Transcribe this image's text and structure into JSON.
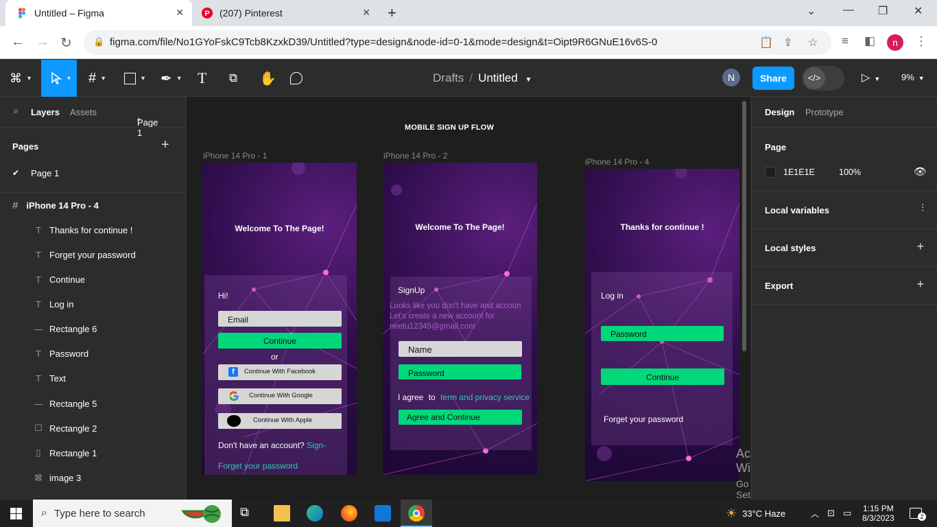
{
  "browser": {
    "tabs": [
      {
        "title": "Untitled – Figma",
        "active": true
      },
      {
        "title": "(207) Pinterest",
        "active": false
      }
    ],
    "url": "figma.com/file/No1GYoFskC9Tcb8KzxkD39/Untitled?type=design&node-id=0-1&mode=design&t=Oipt9R6GNuE16v6S-0",
    "profile_initial": "n"
  },
  "toolbar": {
    "breadcrumb_folder": "Drafts",
    "breadcrumb_separator": "/",
    "file_name": "Untitled",
    "avatar_initial": "N",
    "share_label": "Share",
    "zoom": "9%"
  },
  "left_panel": {
    "tab_layers": "Layers",
    "tab_assets": "Assets",
    "page_selector": "Page 1",
    "pages_header": "Pages",
    "pages": [
      {
        "name": "Page 1",
        "current": true
      }
    ],
    "frame_name": "iPhone 14 Pro - 4",
    "layers": [
      {
        "name": "Thanks for continue !",
        "icon": "text-icon"
      },
      {
        "name": "Forget your password",
        "icon": "text-icon"
      },
      {
        "name": "Continue",
        "icon": "text-icon"
      },
      {
        "name": "Log in",
        "icon": "text-icon"
      },
      {
        "name": "Rectangle 6",
        "icon": "line-icon"
      },
      {
        "name": "Password",
        "icon": "text-icon"
      },
      {
        "name": "Text",
        "icon": "text-icon"
      },
      {
        "name": "Rectangle 5",
        "icon": "line-icon"
      },
      {
        "name": "Rectangle 2",
        "icon": "rectangle-icon"
      },
      {
        "name": "Rectangle 1",
        "icon": "rectangle-icon"
      },
      {
        "name": "image 3",
        "icon": "image-icon"
      }
    ]
  },
  "canvas": {
    "section_title": "MOBILE SIGN UP FLOW",
    "frames": [
      {
        "label": "iPhone 14 Pro - 1",
        "title": "Welcome To The Page!",
        "greeting": "Hi!",
        "email_placeholder": "Email",
        "continue": "Continue",
        "or": "or",
        "facebook": "Continue With Facebook",
        "google": "Continue With Google",
        "apple": "Continue With Apple",
        "no_account": "Don't have an account?",
        "signup_link": "Sign-",
        "forgot": "Forget your password"
      },
      {
        "label": "iPhone 14 Pro - 2",
        "title": "Welcome To The Page!",
        "signup": "SignUp",
        "info_line1": "Looks like you don't have and accoun",
        "info_line2": "Let's create a new account for",
        "info_line3": "neetu12345@gmail.com",
        "name": "Name",
        "password": "Password",
        "agree_prefix": "I agree",
        "agree_to": "to",
        "terms": "term and privacy service",
        "agree_button": "Agree and Continue"
      },
      {
        "label": "iPhone 14 Pro - 4",
        "title": "Thanks for continue !",
        "login": "Log in",
        "password": "Password",
        "continue": "Continue",
        "forgot": "Forget your password"
      }
    ],
    "activate_line1": "Activate Windows",
    "activate_line2": "Go to Settings to activate Windows.",
    "help": "?"
  },
  "right_panel": {
    "tab_design": "Design",
    "tab_prototype": "Prototype",
    "page_header": "Page",
    "bg_color": "1E1E1E",
    "bg_opacity": "100%",
    "local_variables": "Local variables",
    "local_styles": "Local styles",
    "export": "Export"
  },
  "taskbar": {
    "search_placeholder": "Type here to search",
    "weather": "33°C  Haze",
    "time": "1:15 PM",
    "date": "8/3/2023",
    "notifications": "2"
  },
  "colors": {
    "figma_blue": "#0d99ff",
    "green_button": "#00d87a",
    "link_teal": "#36c3b3",
    "canvas_bg": "#1e1e1e"
  }
}
